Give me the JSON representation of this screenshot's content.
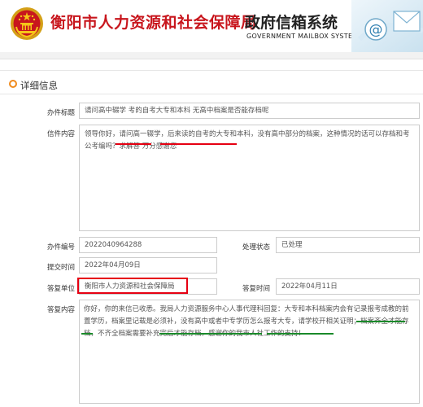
{
  "header": {
    "title_cn": "衡阳市人力资源和社会保障局",
    "title_system": "政府信箱系统",
    "title_en": "GOVERNMENT MAILBOX SYSTEM"
  },
  "section": {
    "title": "详细信息"
  },
  "fields": {
    "subject_label": "办件标题",
    "subject_value": "请问高中辍学 考的自考大专和本科 无高中档案是否能存档呢",
    "content_label": "信件内容",
    "content_value": "领导你好，请问高一辍学，后来读的自考的大专和本科，没有高中部分的档案，这种情况的话可以存档和考公考编吗？求解答 万分感谢您",
    "number_label": "办件编号",
    "number_value": "2022040964288",
    "status_label": "处理状态",
    "status_value": "已处理",
    "submit_time_label": "提交时间",
    "submit_time_value": "2022年04月09日",
    "reply_unit_label": "答复单位",
    "reply_unit_value": "衡阳市人力资源和社会保障局",
    "reply_time_label": "答复时间",
    "reply_time_value": "2022年04月11日",
    "reply_content_label": "答复内容",
    "reply_content_value": "你好，你的来信已收悉。我局人力资源服务中心人事代理科回复：大专和本科档案内会有记录报考成教的前置学历，档案里记载是必须补，没有高中或者中专学历怎么报考大专，请学校开相关证明；档案齐全才能存档，不齐全档案需要补充完后才能存档。感谢你的我市人社工作的支持！"
  },
  "colors": {
    "brand_red": "#c8161d",
    "annotation_red": "#e60012",
    "annotation_green": "#1a8a2a",
    "section_accent": "#f08a1c"
  },
  "icons": [
    "national-emblem-icon",
    "email-at-icon",
    "envelope-icon"
  ]
}
